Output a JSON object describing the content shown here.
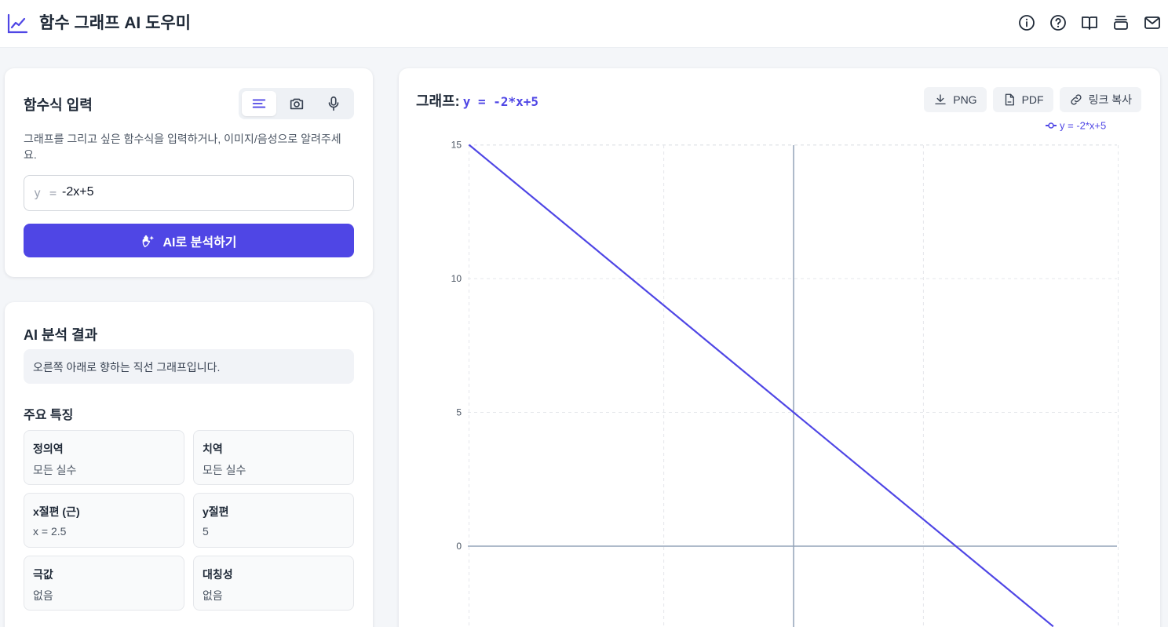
{
  "app": {
    "title": "함수 그래프 AI 도우미"
  },
  "header_icons": [
    "info-icon",
    "help-icon",
    "book-icon",
    "history-icon",
    "mail-icon"
  ],
  "input_panel": {
    "title": "함수식 입력",
    "modes": [
      "text-mode-icon",
      "camera-icon",
      "microphone-icon"
    ],
    "description": "그래프를 그리고 싶은 함수식을 입력하거나, 이미지/음성으로 알려주세요.",
    "prefix": "y =",
    "value": "-2x+5",
    "analyze_label": "AI로 분석하기"
  },
  "result_panel": {
    "title": "AI 분석 결과",
    "summary": "오른쪽 아래로 향하는 직선 그래프입니다.",
    "features_title": "주요 특징",
    "features": [
      {
        "label": "정의역",
        "value": "모든 실수"
      },
      {
        "label": "치역",
        "value": "모든 실수"
      },
      {
        "label": "x절편 (근)",
        "value": "x = 2.5"
      },
      {
        "label": "y절편",
        "value": "5"
      },
      {
        "label": "극값",
        "value": "없음"
      },
      {
        "label": "대칭성",
        "value": "없음"
      }
    ]
  },
  "graph_panel": {
    "title_prefix": "그래프:",
    "equation": "y = -2*x+5",
    "buttons": {
      "png": "PNG",
      "pdf": "PDF",
      "link": "링크 복사"
    }
  },
  "colors": {
    "accent": "#4f46e5",
    "axis": "#94a3b8",
    "grid": "#e5e7eb"
  },
  "chart_data": {
    "type": "line",
    "series": [
      {
        "name": "y = -2*x+5",
        "slope": -2,
        "intercept": 5,
        "color": "#4f46e5"
      }
    ],
    "y_ticks": [
      "15",
      "10",
      "5",
      "0"
    ],
    "xlim": [
      -5,
      5
    ],
    "ylim_visible": [
      -3,
      15
    ],
    "grid": true,
    "legend": "top-right"
  }
}
